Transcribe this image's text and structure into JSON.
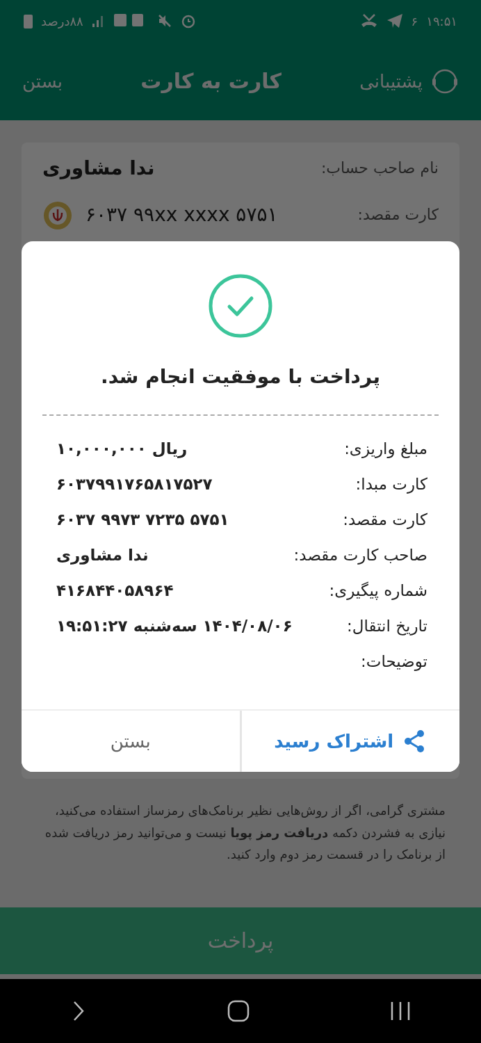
{
  "status_bar": {
    "time": "۱۹:۵۱",
    "notification_count": "۶",
    "battery": "۸۸درصد"
  },
  "header": {
    "support": "پشتیبانی",
    "title": "کارت به کارت",
    "close": "بستن"
  },
  "account_card": {
    "rows": [
      {
        "label": "نام صاحب حساب:",
        "value": "ندا مشاوری",
        "kind": "name"
      },
      {
        "label": "کارت مقصد:",
        "value": "۶۰۳۷ ۹۹xx xxxx ۵۷۵۱",
        "kind": "card"
      }
    ]
  },
  "notice": "مشتری گرامی، اگر از روش‌هایی نظیر برنامک‌های رمزساز استفاده می‌کنید، نیازی به فشردن دکمه **دریافت رمز پویا** نیست و می‌توانید رمز دریافت شده از برنامک را در قسمت رمز دوم وارد کنید.",
  "pay_button": "پرداخت",
  "dialog": {
    "title": "پرداخت با موفقیت انجام شد.",
    "rows": [
      {
        "label": "مبلغ واریزی:",
        "value": "ریال ۱۰,۰۰۰,۰۰۰"
      },
      {
        "label": "کارت مبدا:",
        "value": "۶۰۳۷۹۹۱۷۶۵۸۱۷۵۲۷"
      },
      {
        "label": "کارت مقصد:",
        "value": "۶۰۳۷ ۹۹۷۳ ۷۲۳۵ ۵۷۵۱"
      },
      {
        "label": "صاحب کارت مقصد:",
        "value": "ندا مشاوری"
      },
      {
        "label": "شماره پیگیری:",
        "value": "۴۱۶۸۴۴۰۵۸۹۶۴"
      },
      {
        "label": "تاریخ انتقال:",
        "value": "۱۴۰۴/۰۸/۰۶ سه‌شنبه ۱۹:۵۱:۲۷"
      },
      {
        "label": "توضیحات:"
      }
    ],
    "share_button": "اشتراک رسید",
    "close_button": "بستن"
  }
}
